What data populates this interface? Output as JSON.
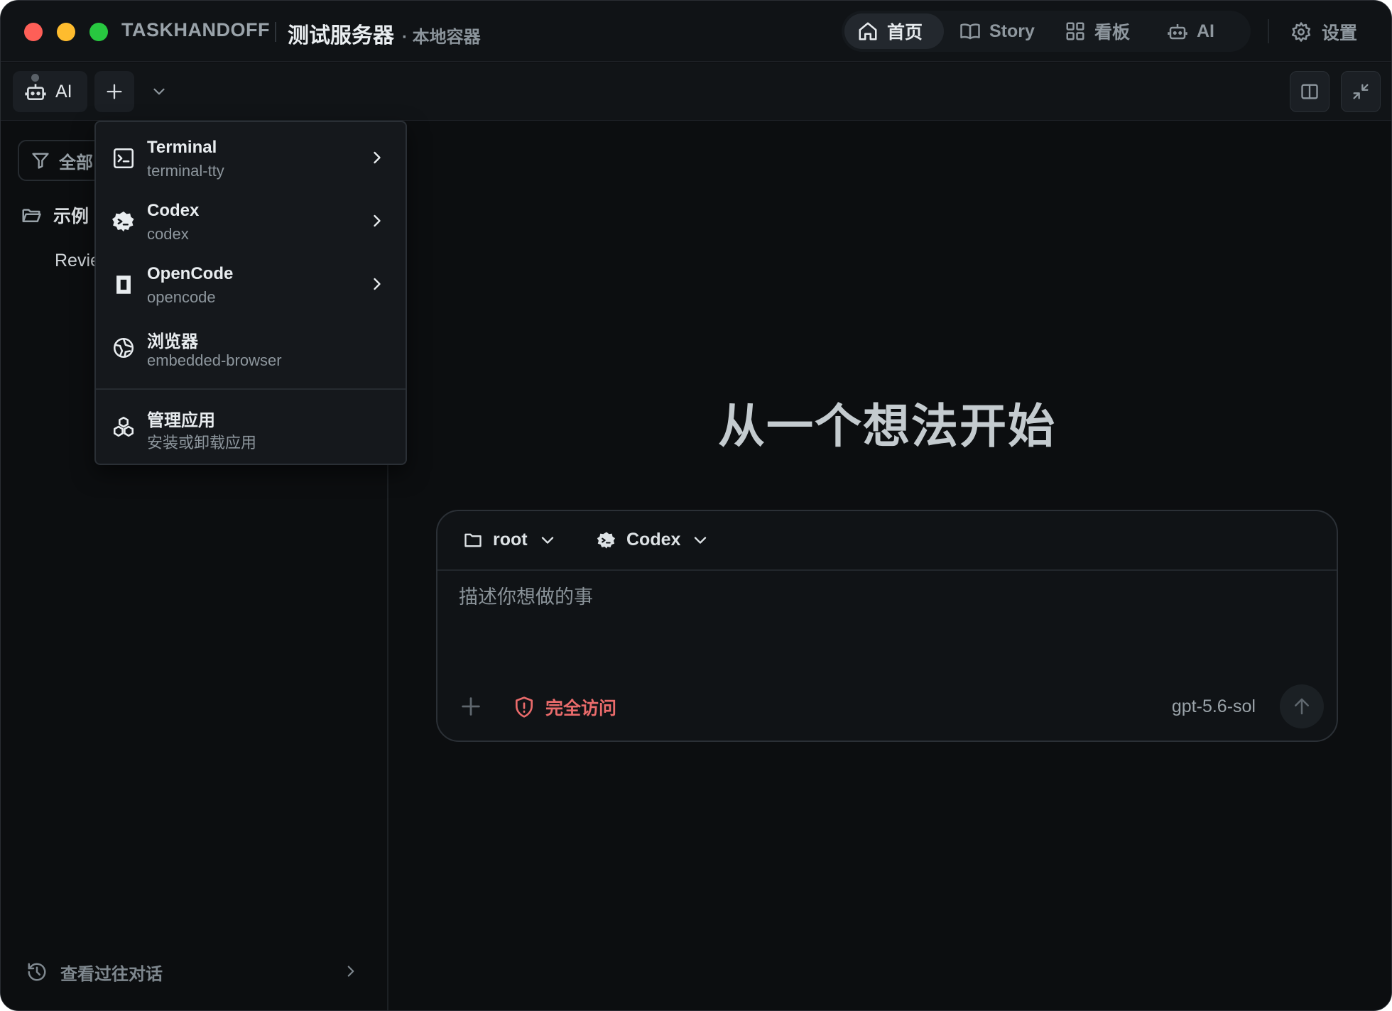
{
  "window": {
    "brand": "TASKHANDOFF",
    "server_name": "测试服务器",
    "server_sub": "· 本地容器"
  },
  "nav": {
    "items": [
      {
        "label": "首页",
        "icon": "home-icon",
        "active": true
      },
      {
        "label": "Story",
        "icon": "book-icon",
        "active": false
      },
      {
        "label": "看板",
        "icon": "grid-icon",
        "active": false
      },
      {
        "label": "AI",
        "icon": "robot-icon",
        "active": false
      }
    ],
    "settings_label": "设置"
  },
  "toolbar": {
    "ai_tab_label": "AI"
  },
  "sidebar": {
    "filter_label": "全部",
    "folder_label": "示例",
    "sub_item": "Revie",
    "history_label": "查看过往对话"
  },
  "menu": {
    "items": [
      {
        "title": "Terminal",
        "subtitle": "terminal-tty",
        "icon": "terminal-icon",
        "has_submenu": true
      },
      {
        "title": "Codex",
        "subtitle": "codex",
        "icon": "codex-icon",
        "has_submenu": true
      },
      {
        "title": "OpenCode",
        "subtitle": "opencode",
        "icon": "opencode-icon",
        "has_submenu": true
      },
      {
        "title": "浏览器",
        "subtitle": "embedded-browser",
        "icon": "browser-icon",
        "has_submenu": false
      }
    ],
    "manage": {
      "title": "管理应用",
      "subtitle": "安装或卸载应用",
      "icon": "apps-icon"
    }
  },
  "main": {
    "hero": "从一个想法开始",
    "composer": {
      "directory": "root",
      "agent": "Codex",
      "placeholder": "描述你想做的事",
      "access_label": "完全访问",
      "model": "gpt-5.6-sol"
    }
  },
  "colors": {
    "background": "#0c0e10",
    "danger": "#ea6b6b",
    "close": "#fe5f57",
    "minimize": "#febc2e",
    "zoom": "#28c840"
  }
}
